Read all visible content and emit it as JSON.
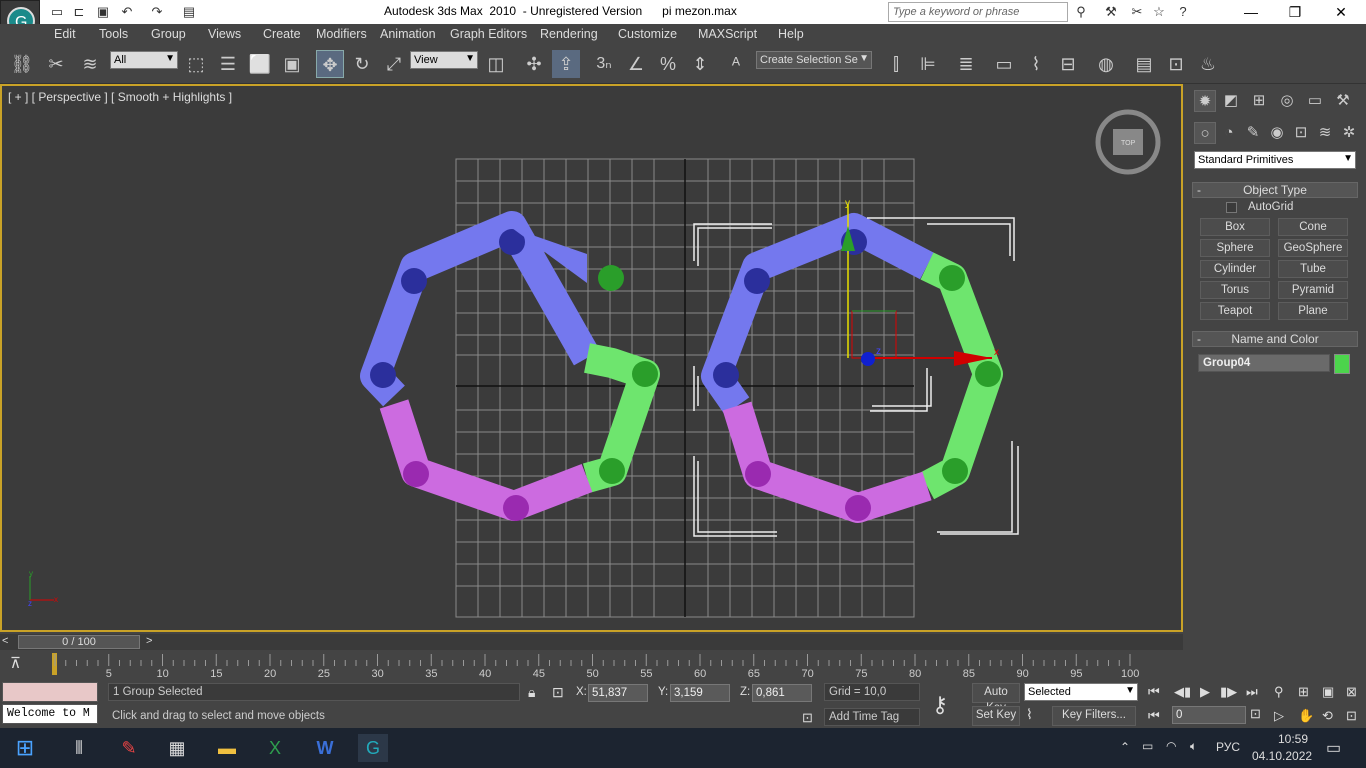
{
  "window": {
    "title": "Autodesk 3ds Max  2010  - Unregistered Version      pi mezon.max",
    "search_placeholder": "Type a keyword or phrase"
  },
  "menu": [
    "Edit",
    "Tools",
    "Group",
    "Views",
    "Create",
    "Modifiers",
    "Animation",
    "Graph Editors",
    "Rendering",
    "Customize",
    "MAXScript",
    "Help"
  ],
  "toolbar": {
    "filter": "All",
    "ref_coord": "View",
    "snap_label": "3",
    "selection_set": "Create Selection Se"
  },
  "viewport": {
    "label": "[ + ] [ Perspective ] [ Smooth + Highlights ]",
    "viewcube": "TOP",
    "gizmo_axes": {
      "x": "x",
      "y": "y",
      "z": "z"
    }
  },
  "colors": {
    "blue": "#7478ee",
    "green": "#6ee56e",
    "purple": "#cc6be0",
    "blue_dot": "#2b2f9c",
    "green_dot": "#2a9e2a",
    "purple_dot": "#9a2ab0",
    "accent": "#c9a227"
  },
  "panel": {
    "dropdown": "Standard Primitives",
    "object_type": {
      "title": "Object Type",
      "autogrid": "AutoGrid",
      "buttons": [
        "Box",
        "Cone",
        "Sphere",
        "GeoSphere",
        "Cylinder",
        "Tube",
        "Torus",
        "Pyramid",
        "Teapot",
        "Plane"
      ]
    },
    "name_color": {
      "title": "Name and Color",
      "name": "Group04",
      "color": "#4cd44c"
    }
  },
  "timeline": {
    "frame": "0 / 100",
    "ticks": [
      "0",
      "5",
      "10",
      "15",
      "20",
      "25",
      "30",
      "35",
      "40",
      "45",
      "50",
      "55",
      "60",
      "65",
      "70",
      "75",
      "80",
      "85",
      "90",
      "95",
      "100"
    ]
  },
  "status": {
    "listener": "Welcome to M",
    "selected": "1 Group Selected",
    "prompt": "Click and drag to select and move objects",
    "x": "51,837",
    "y": "3,159",
    "z": "0,861",
    "grid": "Grid = 10,0",
    "add_time_tag": "Add Time Tag",
    "auto_key": "Auto Key",
    "set_key": "Set Key",
    "key_mode": "Selected",
    "key_filters": "Key Filters...",
    "frame_field": "0"
  },
  "taskbar": {
    "lang": "РУС",
    "time": "10:59",
    "date": "04.10.2022"
  }
}
